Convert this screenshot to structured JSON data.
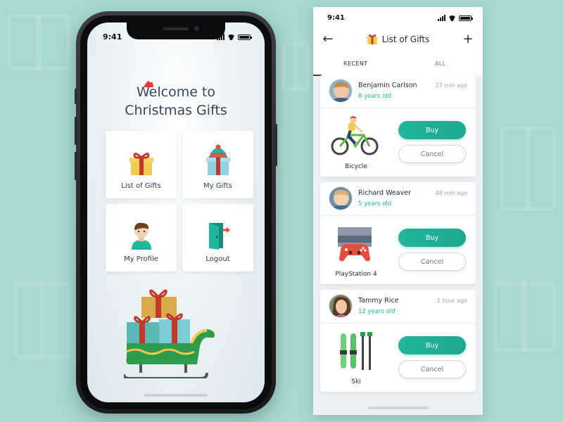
{
  "home": {
    "status_time": "9:41",
    "welcome_title": "Welcome to",
    "welcome_subtitle": "Christmas Gifts",
    "tiles": [
      {
        "label": "List of Gifts",
        "icon": "gift-icon"
      },
      {
        "label": "My Gifts",
        "icon": "gift-with-hat-icon"
      },
      {
        "label": "My Profile",
        "icon": "profile-icon"
      },
      {
        "label": "Logout",
        "icon": "logout-icon"
      }
    ]
  },
  "list": {
    "status_time": "9:41",
    "title": "List of Gifts",
    "tabs": [
      {
        "label": "RECENT",
        "active": true
      },
      {
        "label": "ALL",
        "active": false
      }
    ],
    "cards": [
      {
        "name": "Benjamin Carlson",
        "age": "8 years old",
        "time": "27 min ago",
        "gift": "Bicycle",
        "icon": "bicycle-icon",
        "buy": "Buy",
        "cancel": "Cancel"
      },
      {
        "name": "Richard Weaver",
        "age": "5 years old",
        "time": "48 min ago",
        "gift": "PlayStation 4",
        "icon": "playstation-icon",
        "buy": "Buy",
        "cancel": "Cancel"
      },
      {
        "name": "Tammy Rice",
        "age": "12 years old",
        "time": "1 hour ago",
        "gift": "Ski",
        "icon": "ski-icon",
        "buy": "Buy",
        "cancel": "Cancel"
      }
    ]
  },
  "colors": {
    "background": "#a8d8d2",
    "accent": "#1fb79a",
    "text_dark": "#1e2a3b"
  }
}
